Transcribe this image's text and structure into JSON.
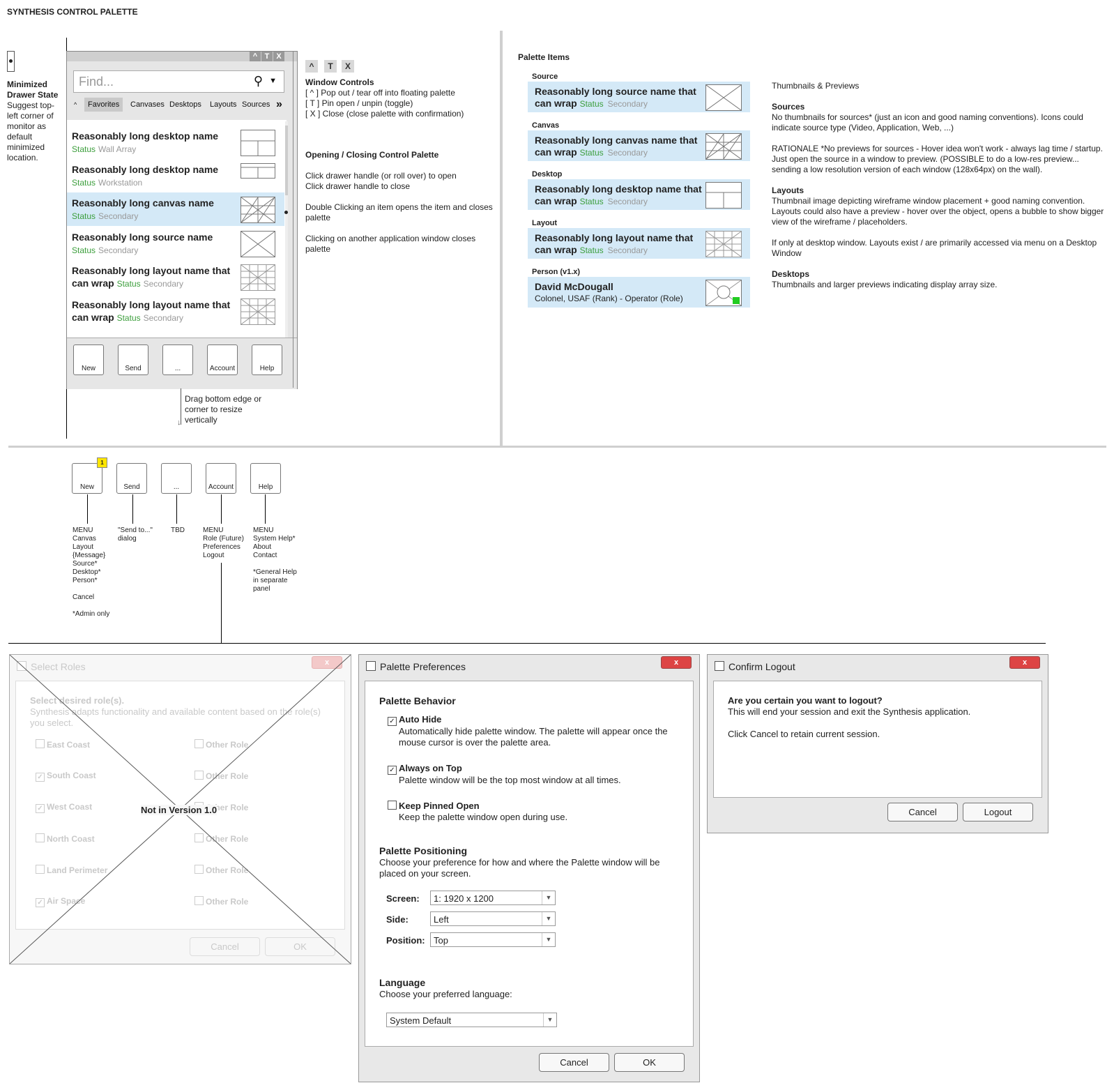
{
  "page_title": "SYNTHESIS CONTROL PALETTE",
  "minimized": {
    "heading": "Minimized Drawer State",
    "text": "Suggest top-left corner of monitor as default minimized location."
  },
  "palette": {
    "window_buttons": [
      "^",
      "T",
      "X"
    ],
    "search_placeholder": "Find...",
    "tabs": [
      "Favorites",
      "Canvases",
      "Desktops",
      "Layouts",
      "Sources"
    ],
    "tabs_more": "»",
    "tabs_collapse": "^",
    "items": [
      {
        "name": "Reasonably long desktop name",
        "status": "Status",
        "secondary": "Wall Array"
      },
      {
        "name": "Reasonably long desktop name",
        "status": "Status",
        "secondary": "Workstation"
      },
      {
        "name": "Reasonably long canvas name",
        "status": "Status",
        "secondary": "Secondary"
      },
      {
        "name": "Reasonably long source name",
        "status": "Status",
        "secondary": "Secondary"
      },
      {
        "name": "Reasonably long layout name that can wrap",
        "status": "Status",
        "secondary": "Secondary"
      },
      {
        "name": "Reasonably long layout name that can wrap",
        "status": "Status",
        "secondary": "Secondary"
      }
    ],
    "buttons": [
      "New",
      "Send",
      "...",
      "Account",
      "Help"
    ],
    "resize_note": "Drag bottom edge or corner to resize vertically"
  },
  "window_controls": {
    "buttons": [
      "^",
      "T",
      "X"
    ],
    "heading": "Window Controls",
    "lines": [
      "[ ^ ] Pop out / tear off into floating palette",
      "[ T ] Pin open / unpin (toggle)",
      "[ X ] Close (close palette with confirmation)"
    ]
  },
  "opening": {
    "heading": "Opening / Closing Control Palette",
    "p1a": "Click drawer handle (or roll over) to open",
    "p1b": "Click drawer handle to close",
    "p2": "Double Clicking an item opens the item and closes palette",
    "p3": "Clicking on another application window closes palette"
  },
  "palette_items": {
    "heading": "Palette Items",
    "source_label": "Source",
    "source_name": "Reasonably long source name that can wrap",
    "canvas_label": "Canvas",
    "canvas_name": "Reasonably long canvas name that can wrap",
    "desktop_label": "Desktop",
    "desktop_name": "Reasonably long desktop name that can wrap",
    "layout_label": "Layout",
    "layout_name": "Reasonably long layout name that can wrap",
    "status": "Status",
    "secondary": "Secondary",
    "person_label": "Person (v1.x)",
    "person_name": "David McDougall",
    "person_sub": "Colonel, USAF (Rank) - Operator (Role)"
  },
  "thumbs": {
    "heading": "Thumbnails & Previews",
    "sources_h": "Sources",
    "sources_t": "No thumbnails for sources* (just an icon and good naming conventions).  Icons could indicate source type (Video, Application, Web, ...)",
    "rationale": "RATIONALE *No previews for sources - Hover idea won't work - always lag time / startup.  Just open the source in a window to preview.  (POSSIBLE to do a low-res preview... sending a low resolution version of each window (128x64px) on the wall).",
    "layouts_h": "Layouts",
    "layouts_t": "Thumbnail image depicting wireframe window placement + good naming convention. Layouts could also have a preview - hover over the object, opens a bubble to show bigger view of the wireframe / placeholders.",
    "layouts_t2": "If only at desktop window. Layouts exist / are primarily accessed via menu on a Desktop Window",
    "desktops_h": "Desktops",
    "desktops_t": "Thumbnails and larger previews indicating display array size."
  },
  "lower": {
    "buttons": [
      "New",
      "Send",
      "...",
      "Account",
      "Help"
    ],
    "badge": "1",
    "new_menu": "MENU\nCanvas\nLayout\n{Message}\nSource*\nDesktop*\nPerson*\n\nCancel\n\n*Admin only",
    "send_menu": "\"Send to...\"\ndialog",
    "tbd": "TBD",
    "account_menu": "MENU\nRole (Future)\nPreferences\nLogout",
    "help_menu": "MENU\nSystem Help*\nAbout\nContact\n\n*General Help\nin separate\npanel"
  },
  "select_roles": {
    "title": "Select Roles",
    "heading": "Select desired role(s).",
    "desc": "Synthesis adapts functionality and available content based on the role(s) you select.",
    "left": [
      {
        "label": "East Coast",
        "checked": false
      },
      {
        "label": "South Coast",
        "checked": true
      },
      {
        "label": "West Coast",
        "checked": true
      },
      {
        "label": "North Coast",
        "checked": false
      },
      {
        "label": "Land Perimeter",
        "checked": false
      },
      {
        "label": "Air Space",
        "checked": true
      }
    ],
    "right": [
      "Other Role",
      "Other Role",
      "Other Role",
      "Other Role",
      "Other Role",
      "Other Role"
    ],
    "cancel": "Cancel",
    "ok": "OK",
    "overlay": "Not in Version 1.0"
  },
  "prefs": {
    "title": "Palette Preferences",
    "behavior_h": "Palette Behavior",
    "auto_hide": "Auto Hide",
    "auto_hide_desc": "Automatically hide palette window.  The palette will appear once the mouse cursor is over the palette area.",
    "on_top": "Always on Top",
    "on_top_desc": "Palette window will be the top most window at all times.",
    "pinned": "Keep Pinned Open",
    "pinned_desc": "Keep the palette window open during use.",
    "positioning_h": "Palette Positioning",
    "positioning_desc": "Choose your preference for how and where the Palette window will be placed on your screen.",
    "screen_label": "Screen:",
    "screen_value": "1: 1920 x 1200",
    "side_label": "Side:",
    "side_value": "Left",
    "position_label": "Position:",
    "position_value": "Top",
    "language_h": "Language",
    "language_desc": "Choose your preferred language:",
    "language_value": "System Default",
    "cancel": "Cancel",
    "ok": "OK"
  },
  "logout": {
    "title": "Confirm Logout",
    "question": "Are you certain you want to logout?",
    "line1": "This will end your session and exit the Synthesis application.",
    "line2": "Click Cancel to retain current session.",
    "cancel": "Cancel",
    "ok": "Logout"
  }
}
